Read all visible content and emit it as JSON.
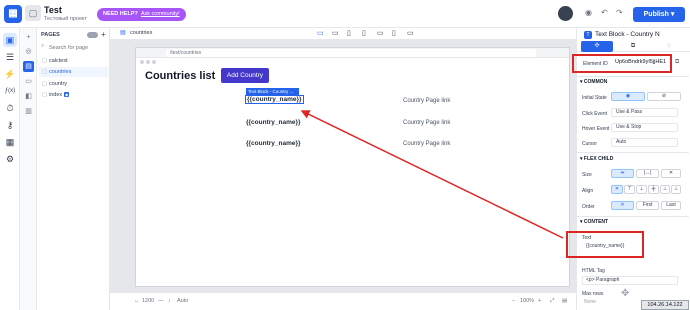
{
  "topbar": {
    "logo_glyph": "▦",
    "project_thumb": "▢",
    "project_name": "Test",
    "project_sub": "Тестовый проект",
    "help_label": "NEED HELP?",
    "help_link": "Ask community!",
    "publish_label": "Publish",
    "eye_icon": "◉",
    "undo_icon": "↶",
    "redo_icon": "↷",
    "chevron": "▾"
  },
  "rail": {
    "items": [
      {
        "glyph": "▣",
        "active": true
      },
      {
        "glyph": "☰"
      },
      {
        "glyph": "⚡"
      },
      {
        "glyph": "ƒ(x)"
      },
      {
        "glyph": "⏱"
      },
      {
        "glyph": "⚷"
      },
      {
        "glyph": "▦"
      },
      {
        "glyph": "⚙"
      }
    ]
  },
  "rail2": {
    "items": [
      {
        "glyph": "+"
      },
      {
        "glyph": "◎"
      },
      {
        "glyph": "▤",
        "active": true
      },
      {
        "glyph": "▭"
      },
      {
        "glyph": "◧"
      },
      {
        "glyph": "▥"
      }
    ]
  },
  "pages": {
    "title": "PAGES",
    "plus": "+",
    "search_placeholder": "Search for page",
    "search_icon": "⌕",
    "page_icon": "▢",
    "items": [
      {
        "label": "calctest"
      },
      {
        "label": "countries",
        "active": true
      },
      {
        "label": "country"
      },
      {
        "label": "index",
        "badge": "◆"
      }
    ]
  },
  "canvas_toolbar": {
    "page_label": "countries",
    "doc_icon": "▤",
    "devices": [
      "▭",
      "▭",
      "▯",
      "▯",
      "▭",
      "▯",
      "▭"
    ]
  },
  "canvas": {
    "url": "/test/countries",
    "heading": "Countries list",
    "add_button": "Add Country",
    "text_block_tag": "Text Block - Country ...",
    "rows": [
      {
        "name": "{{country_name}}",
        "link": "Country Page link"
      },
      {
        "name": "{{country_name}}",
        "link": "Country Page link"
      },
      {
        "name": "{{country_name}}",
        "link": "Country Page link"
      }
    ]
  },
  "bottom_bar": {
    "width_icon": "↔",
    "width_value": "1200",
    "sep": "—",
    "height_icon": "↕",
    "height_value": "Auto",
    "zoom_minus": "−",
    "zoom_value": "100%",
    "zoom_plus": "+",
    "fit_icon": "⤢",
    "doc_icon": "▤"
  },
  "right_panel": {
    "title": "Text Block - Country N",
    "title_icon": "T",
    "tabs": [
      "✣",
      "⧉",
      "◌"
    ],
    "element_id_label": "Element ID",
    "element_id_value": "Up6oBndrk9yI5jjHE1",
    "copy_icon": "⧉",
    "common_title": "COMMON",
    "initial_state_label": "Initial State",
    "initial_state_on": "◉",
    "initial_state_off": "⊘",
    "click_event_label": "Click Event",
    "click_event_value": "Use & Pass",
    "hover_event_label": "Hover Event",
    "hover_event_value": "Use & Stop",
    "cursor_label": "Cursor",
    "cursor_value": "Auto",
    "flex_child_title": "FLEX CHILD",
    "size_label": "Size",
    "size_opts": [
      "⇹",
      "|↔|",
      "✕"
    ],
    "align_label": "Align",
    "align_opts": [
      "✕",
      "⊤",
      "⊥",
      "╪",
      "⊥",
      "⊥"
    ],
    "order_label": "Order",
    "order_opts": [
      "✕",
      "First",
      "Last"
    ],
    "content_title": "CONTENT",
    "text_label": "Text",
    "text_value": "{{country_name}}",
    "html_tag_label": "HTML Tag",
    "html_tag_value": "<p>  Paragraph",
    "max_rows_label": "Max rows",
    "max_rows_value": "None"
  },
  "overlay": {
    "ip_badge": "104.26.14.122",
    "drag_icon": "✥"
  },
  "colors": {
    "primary": "#2563eb",
    "annotation_red": "#dc2626",
    "help_purple": "#a855f7",
    "add_button": "#4338ca"
  }
}
